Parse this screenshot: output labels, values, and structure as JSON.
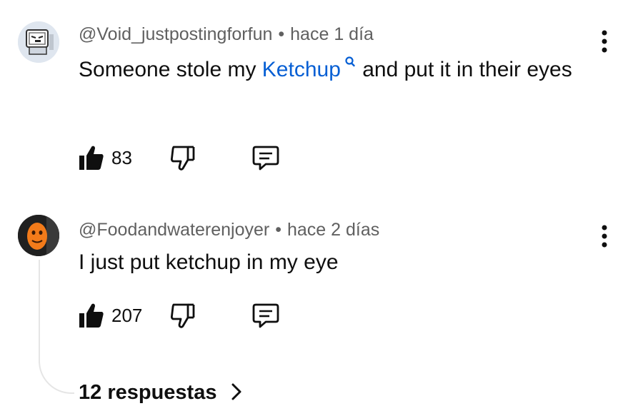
{
  "comments": [
    {
      "author": "@Void_justpostingforfun",
      "separator": "•",
      "time": "hace 1 día",
      "text_before": "Someone stole my ",
      "link_text": "Ketchup",
      "text_after": " and put it in their eyes",
      "likes": "83",
      "avatar_icon": "monitor-face-avatar"
    },
    {
      "author": "@Foodandwaterenjoyer",
      "separator": "•",
      "time": "hace 2 días",
      "text": "I just put ketchup in my eye",
      "likes": "207",
      "avatar_icon": "orange-pumpkin-avatar"
    }
  ],
  "replies_label": "12 respuestas",
  "icons": {
    "like": "thumbs-up-icon",
    "dislike": "thumbs-down-icon",
    "reply": "reply-comment-icon",
    "more": "more-vertical-icon",
    "chevron": "chevron-right-icon"
  },
  "colors": {
    "link": "#065fd4",
    "meta": "#606060",
    "text": "#0f0f0f"
  }
}
